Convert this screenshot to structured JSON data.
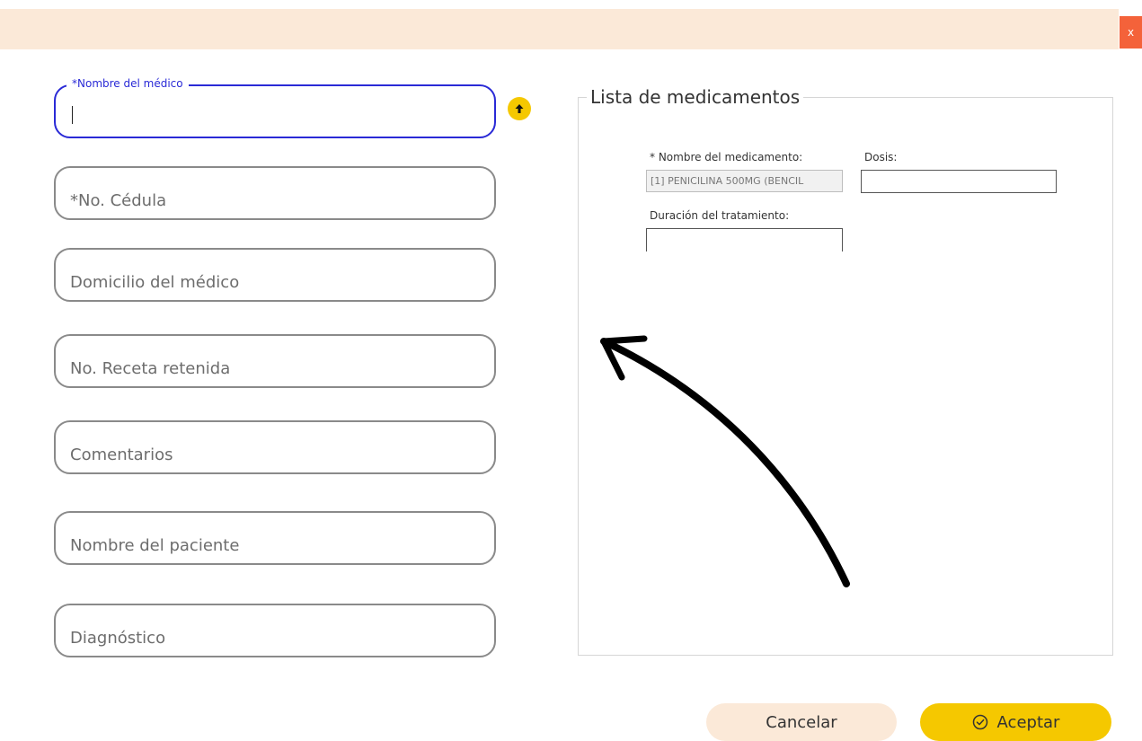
{
  "header": {
    "close_label": "x"
  },
  "form": {
    "doctor_name": {
      "label": "*Nombre del médico",
      "value": ""
    },
    "fields": [
      {
        "placeholder": "*No. Cédula"
      },
      {
        "placeholder": "Domicilio del médico"
      },
      {
        "placeholder": "No. Receta retenida"
      },
      {
        "placeholder": "Comentarios"
      },
      {
        "placeholder": "Nombre del paciente"
      },
      {
        "placeholder": "Diagnóstico"
      }
    ]
  },
  "medications": {
    "title": "Lista de medicamentos",
    "name_label": "* Nombre del medicamento:",
    "name_value": "[1] PENICILINA 500MG (BENCIL",
    "dose_label": "Dosis:",
    "dose_value": "",
    "duration_label": "Duración del tratamiento:",
    "duration_value": ""
  },
  "actions": {
    "cancel_label": "Cancelar",
    "accept_label": "Aceptar"
  },
  "colors": {
    "header_bg": "#fbe9d8",
    "close_bg": "#f4623a",
    "accent_yellow": "#f5c800",
    "active_border": "#2a2ad6"
  },
  "icons": {
    "upload": "arrow-up-icon",
    "accept": "check-circle-icon",
    "annotation": "curved-arrow-icon"
  }
}
